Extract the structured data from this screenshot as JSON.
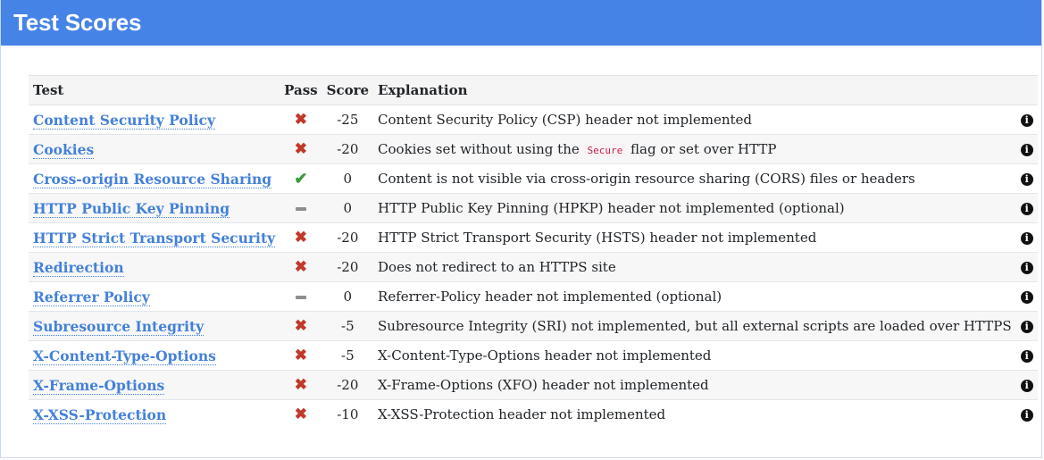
{
  "panel": {
    "title": "Test Scores"
  },
  "table": {
    "headers": {
      "test": "Test",
      "pass": "Pass",
      "score": "Score",
      "explanation": "Explanation"
    },
    "rows": [
      {
        "test": "Content Security Policy",
        "pass": "fail",
        "score": "-25",
        "explanation": "Content Security Policy (CSP) header not implemented"
      },
      {
        "test": "Cookies",
        "pass": "fail",
        "score": "-20",
        "explanation_pre": "Cookies set without using the ",
        "explanation_code": "Secure",
        "explanation_post": " flag or set over HTTP"
      },
      {
        "test": "Cross-origin Resource Sharing",
        "pass": "pass",
        "score": "0",
        "explanation": "Content is not visible via cross-origin resource sharing (CORS) files or headers"
      },
      {
        "test": "HTTP Public Key Pinning",
        "pass": "neutral",
        "score": "0",
        "explanation": "HTTP Public Key Pinning (HPKP) header not implemented (optional)"
      },
      {
        "test": "HTTP Strict Transport Security",
        "pass": "fail",
        "score": "-20",
        "explanation": "HTTP Strict Transport Security (HSTS) header not implemented"
      },
      {
        "test": "Redirection",
        "pass": "fail",
        "score": "-20",
        "explanation": "Does not redirect to an HTTPS site"
      },
      {
        "test": "Referrer Policy",
        "pass": "neutral",
        "score": "0",
        "explanation": "Referrer-Policy header not implemented (optional)"
      },
      {
        "test": "Subresource Integrity",
        "pass": "fail",
        "score": "-5",
        "explanation": "Subresource Integrity (SRI) not implemented, but all external scripts are loaded over HTTPS"
      },
      {
        "test": "X-Content-Type-Options",
        "pass": "fail",
        "score": "-5",
        "explanation": "X-Content-Type-Options header not implemented"
      },
      {
        "test": "X-Frame-Options",
        "pass": "fail",
        "score": "-20",
        "explanation": "X-Frame-Options (XFO) header not implemented"
      },
      {
        "test": "X-XSS-Protection",
        "pass": "fail",
        "score": "-10",
        "explanation": "X-XSS-Protection header not implemented"
      }
    ]
  },
  "icons": {
    "fail": "x-mark-icon",
    "pass": "checkmark-icon",
    "neutral": "dash-icon",
    "info": "info-icon"
  },
  "colors": {
    "header_bg": "#4583e7",
    "link": "#4481d9",
    "fail": "#c0392b",
    "pass": "#3a9b3a",
    "neutral": "#8e8e8e"
  }
}
